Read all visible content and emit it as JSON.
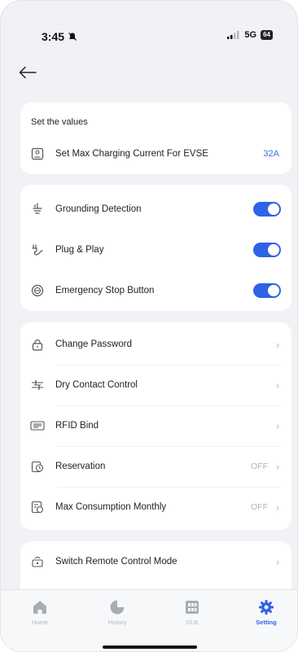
{
  "status_bar": {
    "time": "3:45",
    "network": "5G",
    "battery": "64"
  },
  "values_card": {
    "title": "Set the values",
    "rows": [
      {
        "label": "Set Max Charging Current For EVSE",
        "value": "32A",
        "icon": "evse-icon"
      }
    ]
  },
  "toggles_card": {
    "rows": [
      {
        "label": "Grounding Detection",
        "icon": "grounding-icon",
        "on": true
      },
      {
        "label": "Plug & Play",
        "icon": "plug-icon",
        "on": true
      },
      {
        "label": "Emergency Stop Button",
        "icon": "emergency-stop-icon",
        "on": true
      }
    ]
  },
  "settings_card": {
    "rows": [
      {
        "label": "Change Password",
        "icon": "lock-icon"
      },
      {
        "label": "Dry Contact Control",
        "icon": "dry-contact-icon"
      },
      {
        "label": "RFID Bind",
        "icon": "rfid-icon"
      },
      {
        "label": "Reservation",
        "icon": "reservation-icon",
        "status": "OFF"
      },
      {
        "label": "Max Consumption Monthly",
        "icon": "consumption-icon",
        "status": "OFF"
      }
    ]
  },
  "remote_card": {
    "rows": [
      {
        "label": "Switch Remote Control Mode",
        "icon": "remote-icon"
      }
    ]
  },
  "tabbar": {
    "tabs": [
      {
        "label": "Home",
        "icon": "home-icon",
        "active": false
      },
      {
        "label": "History",
        "icon": "history-icon",
        "active": false
      },
      {
        "label": "DLB",
        "icon": "dlb-icon",
        "active": false
      },
      {
        "label": "Setting",
        "icon": "gear-icon",
        "active": true
      }
    ]
  },
  "colors": {
    "accent": "#2f63e6",
    "background": "#f1f2f5",
    "card": "#ffffff",
    "muted": "#b0b3b8"
  }
}
